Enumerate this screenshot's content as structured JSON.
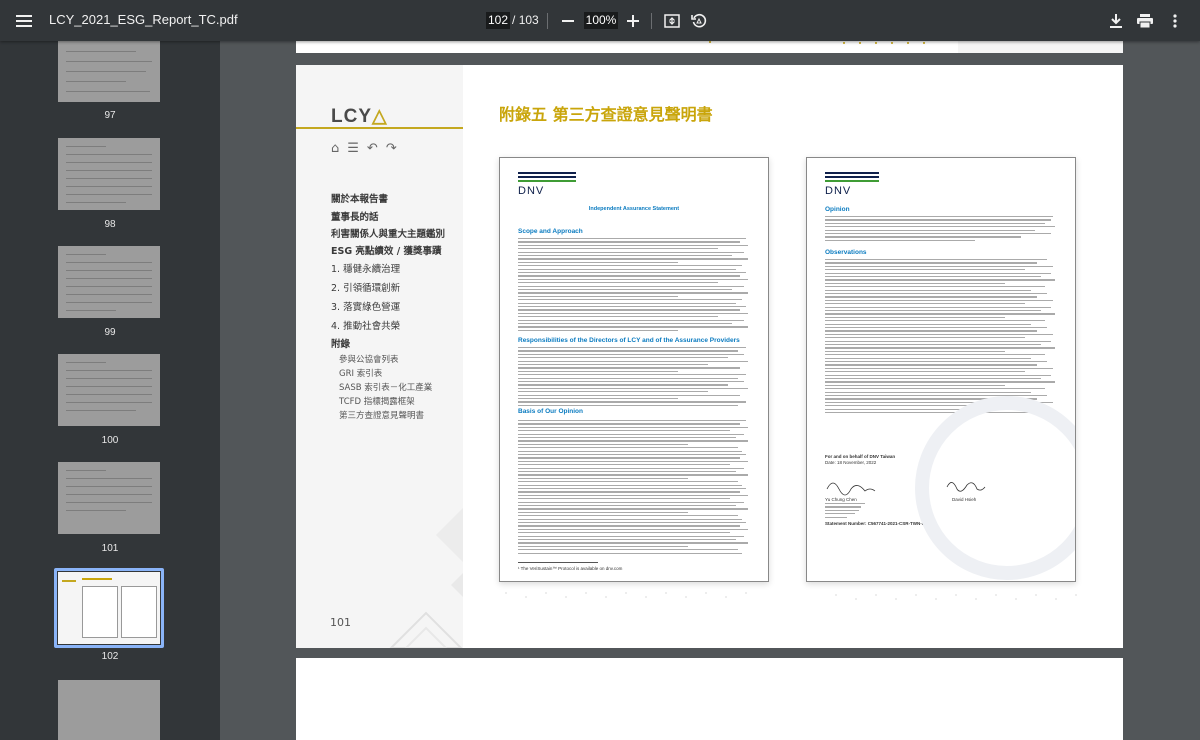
{
  "toolbar": {
    "filename": "LCY_2021_ESG_Report_TC.pdf",
    "current_page": "102",
    "page_separator": "/",
    "total_pages": "103",
    "zoom": "100%"
  },
  "sidebar": {
    "thumbnails": [
      {
        "label": "97"
      },
      {
        "label": "98"
      },
      {
        "label": "99"
      },
      {
        "label": "100"
      },
      {
        "label": "101"
      },
      {
        "label": "102",
        "selected": true
      }
    ]
  },
  "page": {
    "logo_text": "LCY",
    "title": "附錄五 第三方查證意見聲明書",
    "page_number": "101",
    "nav": [
      {
        "label": "關於本報告書",
        "style": "b"
      },
      {
        "label": "董事長的話",
        "style": "b"
      },
      {
        "label": "利害關係人與重大主題鑑別",
        "style": "b"
      },
      {
        "label": "ESG 亮點績效 / 獲獎事蹟",
        "style": "b"
      },
      {
        "label": "1. 穩健永續治理",
        "style": "n"
      },
      {
        "label": "2. 引領循環創新",
        "style": "n"
      },
      {
        "label": "3. 落實綠色營運",
        "style": "n"
      },
      {
        "label": "4. 推動社會共榮",
        "style": "n"
      },
      {
        "label": "附錄",
        "style": "b"
      },
      {
        "label": "參與公協會列表",
        "style": "s"
      },
      {
        "label": "GRI 索引表",
        "style": "s"
      },
      {
        "label": "SASB 索引表－化工產業",
        "style": "s"
      },
      {
        "label": "TCFD 指標揭露框架",
        "style": "s"
      },
      {
        "label": "第三方查證意見聲明書",
        "style": "s"
      }
    ],
    "left_doc": {
      "brand": "DNV",
      "heading": "Independent Assurance Statement",
      "section1": "Scope and Approach",
      "section2": "Responsibilities of the Directors of LCY and of the Assurance Providers",
      "section3": "Basis of Our Opinion",
      "footnote": "¹ The VeriSustain™ Protocol is available on dnv.com"
    },
    "right_doc": {
      "brand": "DNV",
      "section1": "Opinion",
      "section2": "Observations",
      "signer_date": "For and on behalf of DNV Taiwan",
      "date_line": "Date: 18 November, 2022",
      "signer1": "Yu Chung Chen",
      "signer2": "David Hsieh",
      "statement_no": "Statement Number: C567741-2021-CSR-TWN-DNV"
    }
  }
}
